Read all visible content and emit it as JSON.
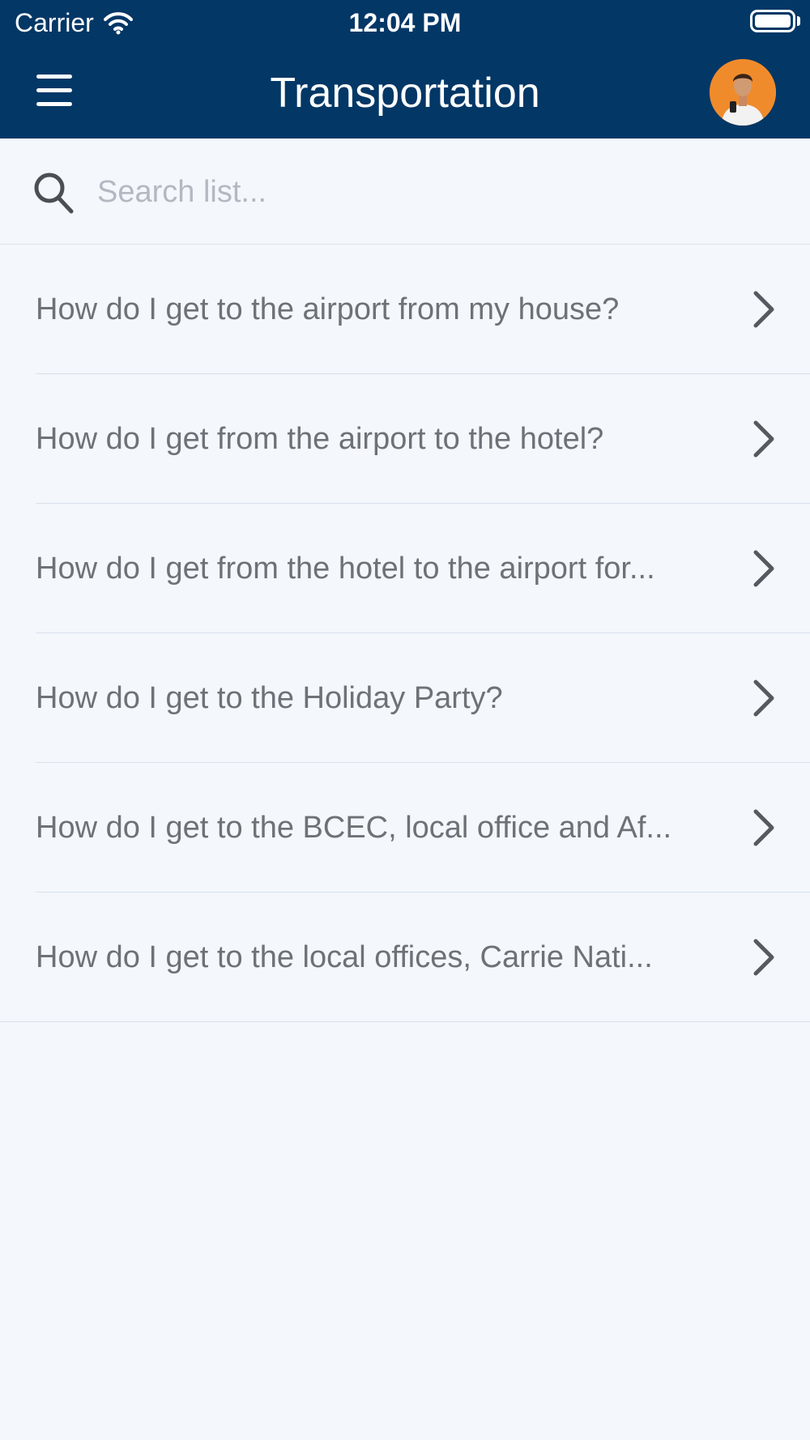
{
  "status_bar": {
    "carrier": "Carrier",
    "time": "12:04 PM"
  },
  "header": {
    "title": "Transportation"
  },
  "search": {
    "placeholder": "Search list..."
  },
  "items": [
    {
      "label": "How do I get to the airport from my house?"
    },
    {
      "label": "How do I get from the airport to the hotel?"
    },
    {
      "label": "How do I get from the hotel to the airport for..."
    },
    {
      "label": "How do I get to the Holiday Party?"
    },
    {
      "label": "How do I get to the BCEC, local office and Af..."
    },
    {
      "label": "How do I get to the local offices, Carrie Nati..."
    }
  ],
  "icons": {
    "menu": "hamburger-menu-icon",
    "search": "search-icon",
    "chevron": "chevron-right-icon",
    "wifi": "wifi-icon",
    "battery": "battery-icon"
  },
  "colors": {
    "header_bg": "#023766",
    "page_bg": "#f4f7fb",
    "item_text": "#6d7278",
    "chevron": "#555a61",
    "placeholder": "#b3b8c2",
    "avatar_bg": "#f08b2c"
  }
}
